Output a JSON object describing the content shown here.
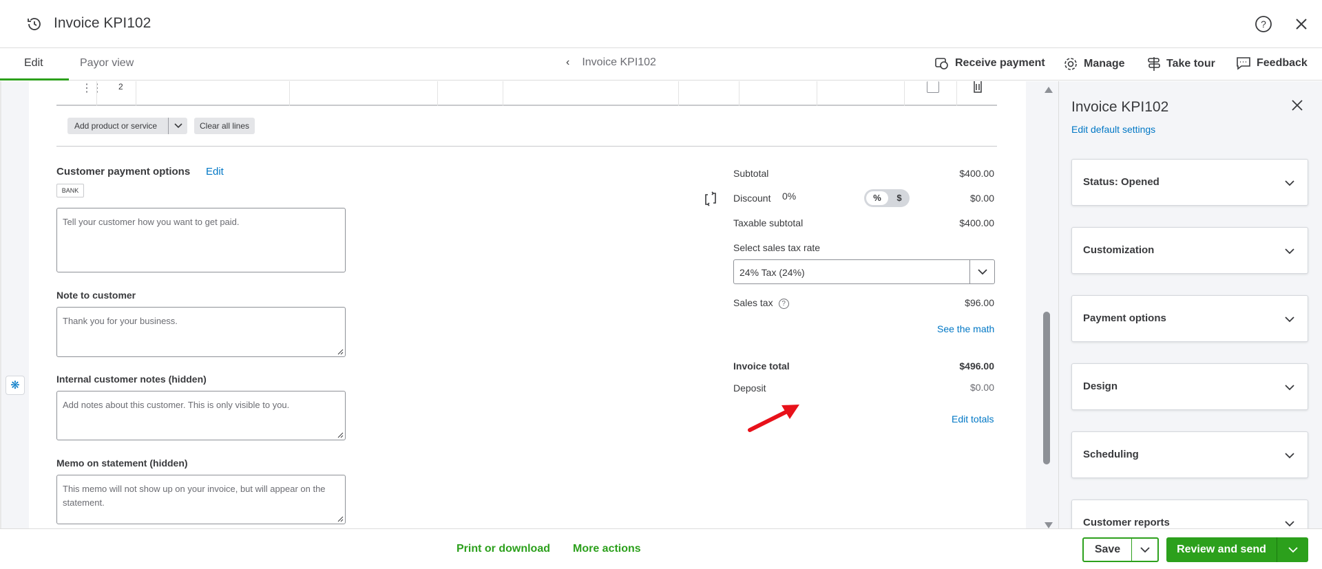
{
  "header": {
    "title": "Invoice KPI102"
  },
  "tabs": {
    "edit": "Edit",
    "payor": "Payor view"
  },
  "nav": {
    "center": "Invoice KPI102"
  },
  "actions": {
    "receive": "Receive payment",
    "manage": "Manage",
    "tour": "Take tour",
    "feedback": "Feedback"
  },
  "line": {
    "num": "2"
  },
  "buttons": {
    "add": "Add product or service",
    "clear": "Clear all lines"
  },
  "payment": {
    "title": "Customer payment options",
    "edit": "Edit",
    "bank": "BANK",
    "placeholder": "Tell your customer how you want to get paid."
  },
  "note": {
    "label": "Note to customer",
    "value": "Thank you for your business."
  },
  "internal": {
    "label": "Internal customer notes (hidden)",
    "placeholder": "Add notes about this customer. This is only visible to you."
  },
  "memo": {
    "label": "Memo on statement (hidden)",
    "placeholder": "This memo will not show up on your invoice, but will appear on the statement."
  },
  "totals": {
    "subtotal_label": "Subtotal",
    "subtotal": "$400.00",
    "discount_label": "Discount",
    "discount_pct": "0%",
    "discount_mode_pct": "%",
    "discount_mode_dollar": "$",
    "discount": "$0.00",
    "taxable_label": "Taxable subtotal",
    "taxable": "$400.00",
    "taxrate_label": "Select sales tax rate",
    "taxrate": "24% Tax (24%)",
    "salestax_label": "Sales tax",
    "salestax": "$96.00",
    "see_math": "See the math",
    "total_label": "Invoice total",
    "total": "$496.00",
    "deposit_label": "Deposit",
    "deposit": "$0.00",
    "edit_totals": "Edit totals"
  },
  "panel": {
    "title": "Invoice KPI102",
    "link": "Edit default settings",
    "cards": [
      "Status: Opened",
      "Customization",
      "Payment options",
      "Design",
      "Scheduling",
      "Customer reports"
    ]
  },
  "footer": {
    "print": "Print or download",
    "more": "More actions",
    "save": "Save",
    "send": "Review and send"
  },
  "colors": {
    "green": "#2ca01c",
    "blue": "#0077c5",
    "annotation": "#e8111a"
  }
}
